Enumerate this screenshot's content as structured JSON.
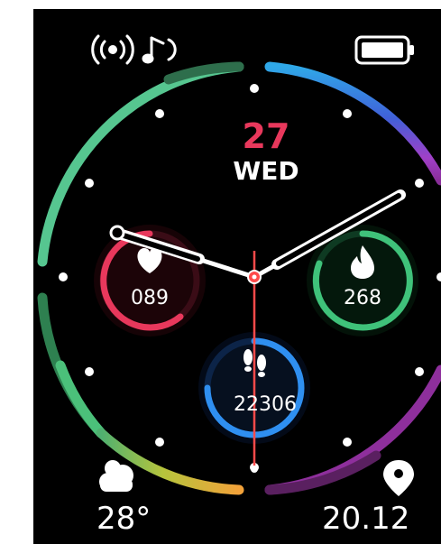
{
  "date": {
    "day_number": "27",
    "weekday": "WED"
  },
  "status": {
    "icons": [
      "wireless-signal-icon",
      "music-note-icon",
      "battery-full-icon"
    ]
  },
  "complications": {
    "heart_rate": {
      "icon": "heart-icon",
      "value": "089",
      "color": "#e8385c"
    },
    "calories": {
      "icon": "flame-icon",
      "value": "268",
      "color": "#3fc27a"
    },
    "steps": {
      "icon": "footprints-icon",
      "value": "22306",
      "color": "#2f8ff0"
    }
  },
  "weather": {
    "icon": "cloud-icon",
    "temperature": "28°"
  },
  "location": {
    "icon": "location-pin-icon",
    "distance": "20.12"
  },
  "hands": {
    "hour_color": "#ffffff",
    "minute_color": "#ffffff",
    "second_color": "#ff4a4a"
  }
}
